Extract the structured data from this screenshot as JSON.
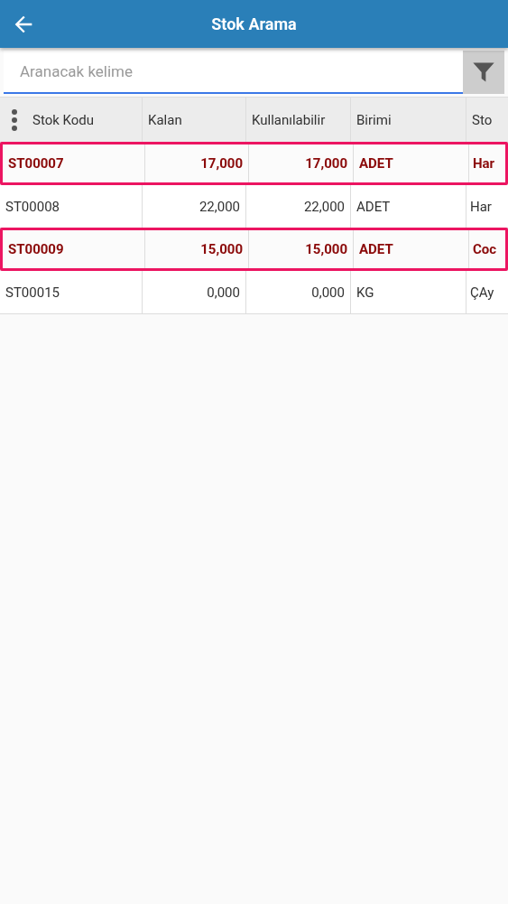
{
  "app_bar": {
    "title": "Stok Arama"
  },
  "search": {
    "placeholder": "Aranacak kelime"
  },
  "table": {
    "columns": [
      "Stok Kodu",
      "Kalan",
      "Kullanılabilir",
      "Birimi",
      "Sto"
    ],
    "rows": [
      {
        "cells": [
          "ST00007",
          "17,000",
          "17,000",
          "ADET",
          "Har"
        ],
        "selected": true
      },
      {
        "cells": [
          "ST00008",
          "22,000",
          "22,000",
          "ADET",
          "Har"
        ],
        "selected": false
      },
      {
        "cells": [
          "ST00009",
          "15,000",
          "15,000",
          "ADET",
          "Coc"
        ],
        "selected": true
      },
      {
        "cells": [
          "ST00015",
          "0,000",
          "0,000",
          "KG",
          "ÇAy"
        ],
        "selected": false
      }
    ]
  }
}
